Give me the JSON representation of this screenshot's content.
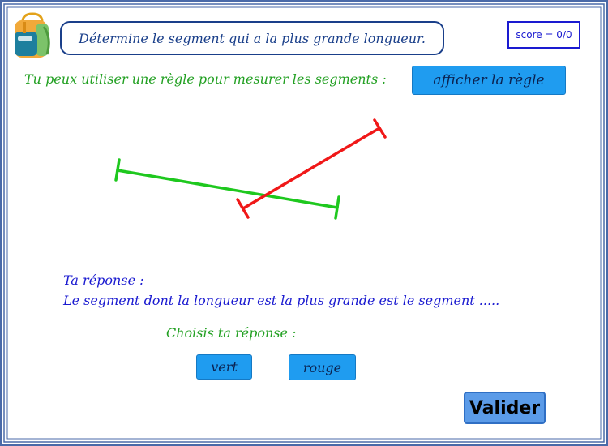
{
  "instruction": "Détermine le segment qui a la plus grande longueur.",
  "score": "score = 0/0",
  "ruler_hint": "Tu peux utiliser une règle pour mesurer les segments :",
  "ruler_button": "afficher la règle",
  "answer_label": "Ta réponse :",
  "answer_sentence": "Le segment dont la longueur est la plus grande est le segment .....",
  "choose_label": "Choisis ta réponse :",
  "choices": [
    "vert",
    "rouge"
  ],
  "validate_button": "Valider",
  "segments": [
    {
      "name": "vert",
      "color": "#1ec81e"
    },
    {
      "name": "rouge",
      "color": "#f01818"
    }
  ],
  "colors": {
    "frame": "#4a6aa8",
    "button": "#1f9cf0",
    "validate": "#5b9be8",
    "instruction_text": "#1a3f8a",
    "green_text": "#22a022",
    "blue_text": "#1a1ad0"
  },
  "icons": {
    "bag": "school-bag-icon"
  }
}
